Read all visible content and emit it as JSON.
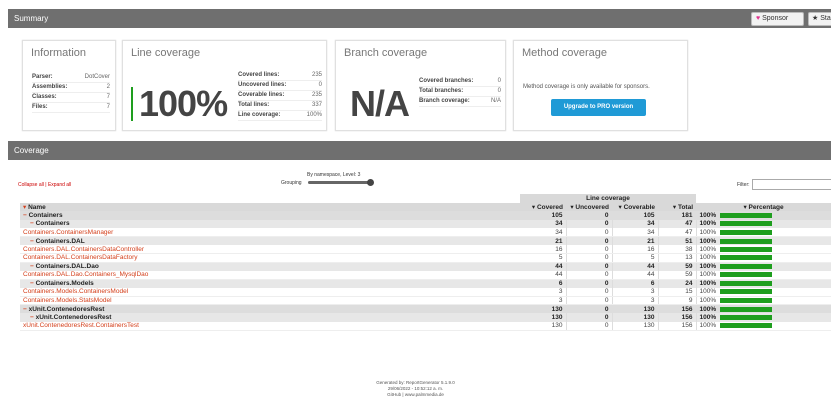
{
  "summary_bar": {
    "title": "Summary",
    "sponsor_label": "Sponsor",
    "star_label": "Sta"
  },
  "information": {
    "title": "Information",
    "rows": [
      {
        "k": "Parser:",
        "v": "DotCover"
      },
      {
        "k": "Assemblies:",
        "v": "2"
      },
      {
        "k": "Classes:",
        "v": "7"
      },
      {
        "k": "Files:",
        "v": "7"
      }
    ]
  },
  "line_coverage": {
    "title": "Line coverage",
    "big": "100%",
    "rows": [
      {
        "k": "Covered lines:",
        "v": "235"
      },
      {
        "k": "Uncovered lines:",
        "v": "0"
      },
      {
        "k": "Coverable lines:",
        "v": "235"
      },
      {
        "k": "Total lines:",
        "v": "337"
      },
      {
        "k": "Line coverage:",
        "v": "100%"
      }
    ]
  },
  "branch_coverage": {
    "title": "Branch coverage",
    "big": "N/A",
    "rows": [
      {
        "k": "Covered branches:",
        "v": "0"
      },
      {
        "k": "Total branches:",
        "v": "0"
      },
      {
        "k": "Branch coverage:",
        "v": "N/A"
      }
    ]
  },
  "method_coverage": {
    "title": "Method coverage",
    "text": "Method coverage is only available for sponsors.",
    "button": "Upgrade to PRO version"
  },
  "coverage_bar": {
    "title": "Coverage"
  },
  "controls": {
    "collapse_all": "Collapse all",
    "separator": " | ",
    "expand_all": "Expand all",
    "grouping_top": "By namespace, Level: 3",
    "grouping_label": "Grouping",
    "filter_label": "Filter:"
  },
  "table": {
    "group_header": "Line coverage",
    "headers": [
      "Name",
      "Covered",
      "Uncovered",
      "Coverable",
      "Total",
      "Percentage"
    ],
    "rows": [
      {
        "level": "lvl1",
        "name": "Containers",
        "covered": "105",
        "uncovered": "0",
        "coverable": "105",
        "total": "181",
        "pct": "100%"
      },
      {
        "level": "lvl2",
        "name": "Containers",
        "covered": "34",
        "uncovered": "0",
        "coverable": "34",
        "total": "47",
        "pct": "100%"
      },
      {
        "level": "cls",
        "name": "Containers.ContainersManager",
        "covered": "34",
        "uncovered": "0",
        "coverable": "34",
        "total": "47",
        "pct": "100%"
      },
      {
        "level": "lvl2",
        "name": "Containers.DAL",
        "covered": "21",
        "uncovered": "0",
        "coverable": "21",
        "total": "51",
        "pct": "100%"
      },
      {
        "level": "cls",
        "name": "Containers.DAL.ContainersDataController",
        "covered": "16",
        "uncovered": "0",
        "coverable": "16",
        "total": "38",
        "pct": "100%"
      },
      {
        "level": "cls",
        "name": "Containers.DAL.ContainersDataFactory",
        "covered": "5",
        "uncovered": "0",
        "coverable": "5",
        "total": "13",
        "pct": "100%"
      },
      {
        "level": "lvl2",
        "name": "Containers.DAL.Dao",
        "covered": "44",
        "uncovered": "0",
        "coverable": "44",
        "total": "59",
        "pct": "100%"
      },
      {
        "level": "cls",
        "name": "Containers.DAL.Dao.Containers_MysqlDao",
        "covered": "44",
        "uncovered": "0",
        "coverable": "44",
        "total": "59",
        "pct": "100%"
      },
      {
        "level": "lvl2",
        "name": "Containers.Models",
        "covered": "6",
        "uncovered": "0",
        "coverable": "6",
        "total": "24",
        "pct": "100%"
      },
      {
        "level": "cls",
        "name": "Containers.Models.ContainersModel",
        "covered": "3",
        "uncovered": "0",
        "coverable": "3",
        "total": "15",
        "pct": "100%"
      },
      {
        "level": "cls",
        "name": "Containers.Models.StatsModel",
        "covered": "3",
        "uncovered": "0",
        "coverable": "3",
        "total": "9",
        "pct": "100%"
      },
      {
        "level": "lvl1",
        "name": "xUnit.ContenedoresRest",
        "covered": "130",
        "uncovered": "0",
        "coverable": "130",
        "total": "156",
        "pct": "100%"
      },
      {
        "level": "lvl2",
        "name": "xUnit.ContenedoresRest",
        "covered": "130",
        "uncovered": "0",
        "coverable": "130",
        "total": "156",
        "pct": "100%"
      },
      {
        "level": "cls",
        "name": "xUnit.ContenedoresRest.ContainersTest",
        "covered": "130",
        "uncovered": "0",
        "coverable": "130",
        "total": "156",
        "pct": "100%"
      }
    ]
  },
  "footer": {
    "line1": "Generated by: ReportGenerator 5.1.9.0",
    "line2": "29/06/2022 - 10:52:12 a. m.",
    "line3": "GitHub | www.palmmedia.de"
  },
  "colors": {
    "accent_green": "#1e9e1e",
    "bar_grey": "#6f6f6f",
    "link_red": "#d4401c",
    "pro_blue": "#1f9ad6"
  }
}
